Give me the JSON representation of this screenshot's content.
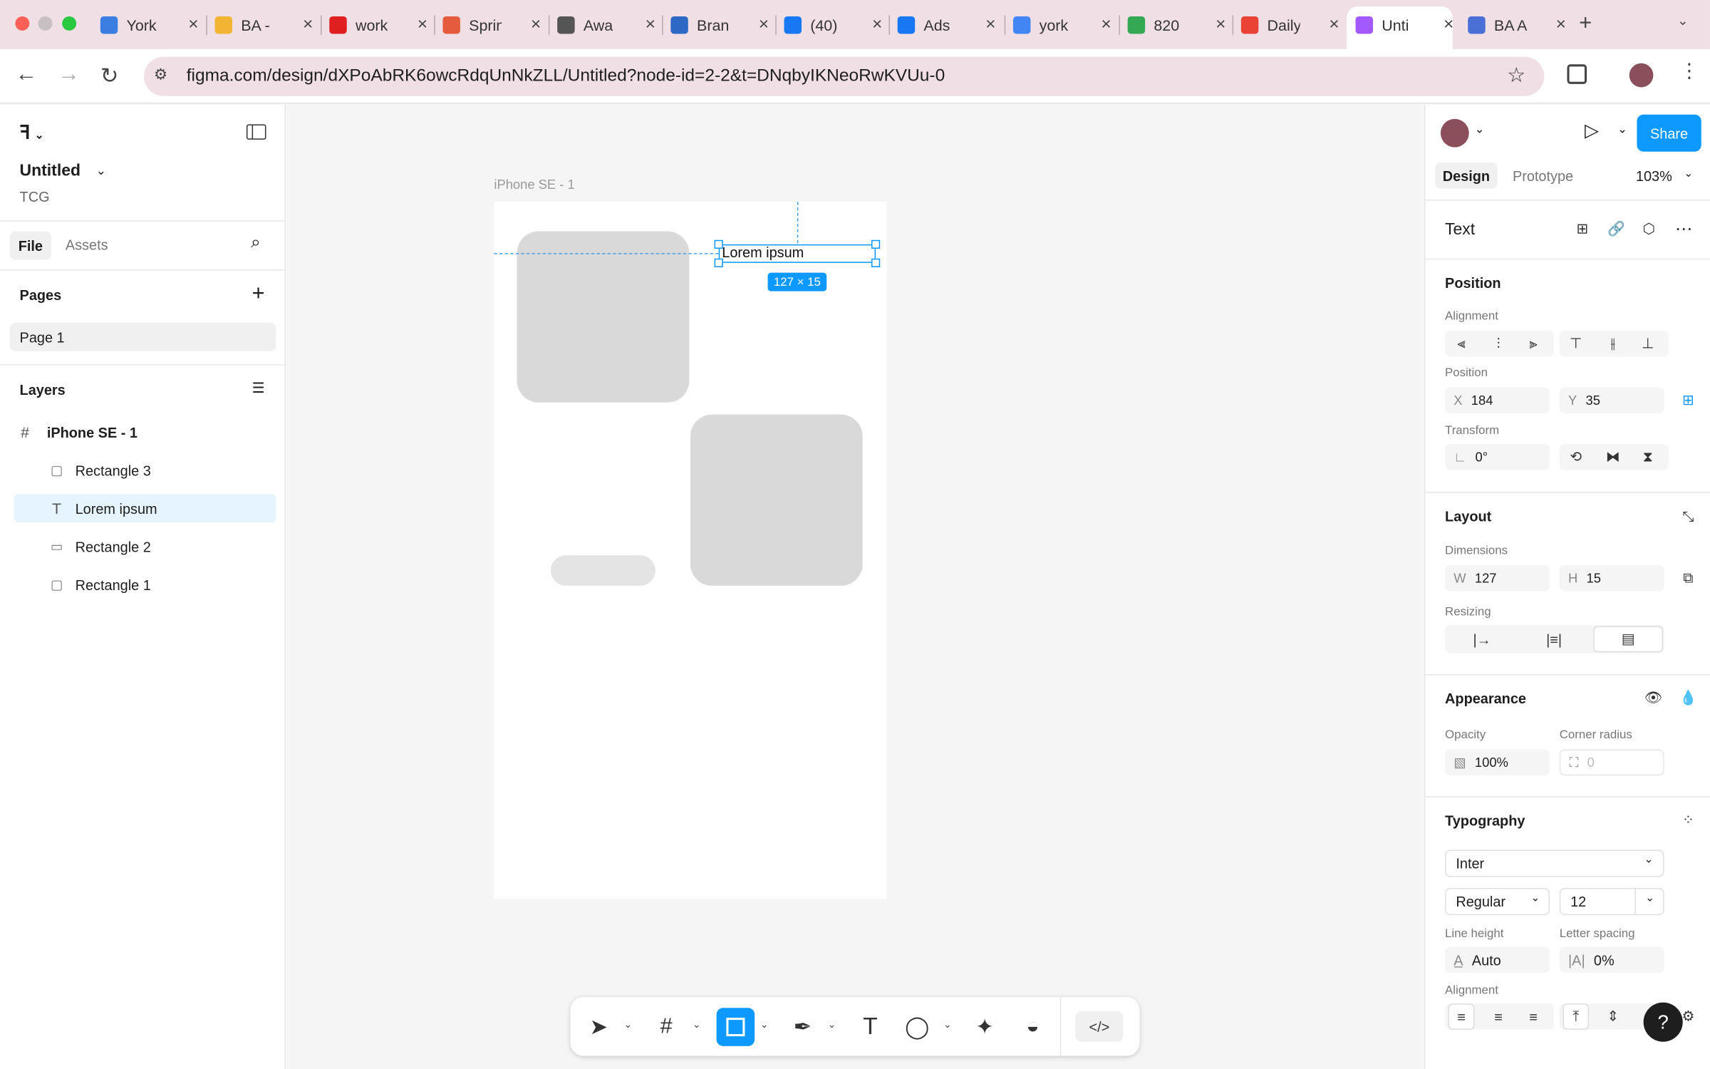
{
  "browser": {
    "tabs": [
      {
        "title": "York",
        "color": "#3b7de0"
      },
      {
        "title": "BA -",
        "color": "#f2b533"
      },
      {
        "title": "work",
        "color": "#e02020"
      },
      {
        "title": "Sprin",
        "color": "#e45b3d"
      },
      {
        "title": "Awa",
        "color": "#555555"
      },
      {
        "title": "Bran",
        "color": "#2d68c4"
      },
      {
        "title": "(40)",
        "color": "#1877f2"
      },
      {
        "title": "Ads",
        "color": "#1877f2"
      },
      {
        "title": "york",
        "color": "#4285f4"
      },
      {
        "title": "820",
        "color": "#34a853"
      },
      {
        "title": "Daily",
        "color": "#ea4335"
      },
      {
        "title": "Unti",
        "color": "#a259ff"
      },
      {
        "title": "BA A",
        "color": "#4a6fd6"
      }
    ],
    "url": "figma.com/design/dXPoAbRK6owcRdqUnNkZLL/Untitled?node-id=2-2&t=DNqbyIKNeoRwKVUu-0"
  },
  "left_panel": {
    "file_name": "Untitled",
    "team": "TCG",
    "tabs": {
      "file": "File",
      "assets": "Assets"
    },
    "pages_title": "Pages",
    "pages": [
      "Page 1"
    ],
    "layers_title": "Layers",
    "frame": "iPhone SE - 1",
    "layers": [
      {
        "name": "Rectangle 3",
        "icon": "rect"
      },
      {
        "name": "Lorem ipsum",
        "icon": "text"
      },
      {
        "name": "Rectangle 2",
        "icon": "pill"
      },
      {
        "name": "Rectangle 1",
        "icon": "rect"
      }
    ]
  },
  "canvas": {
    "frame_label": "iPhone SE - 1",
    "text_content": "Lorem ipsum",
    "size_badge": "127 × 15"
  },
  "right_panel": {
    "tabs": {
      "design": "Design",
      "prototype": "Prototype"
    },
    "zoom": "103%",
    "share": "Share",
    "element_type": "Text",
    "position": {
      "title": "Position",
      "alignment_label": "Alignment",
      "position_label": "Position",
      "x_prefix": "X",
      "x": "184",
      "y_prefix": "Y",
      "y": "35",
      "transform_label": "Transform",
      "rotation": "0°"
    },
    "layout": {
      "title": "Layout",
      "dimensions_label": "Dimensions",
      "w_prefix": "W",
      "w": "127",
      "h_prefix": "H",
      "h": "15",
      "resizing_label": "Resizing"
    },
    "appearance": {
      "title": "Appearance",
      "opacity_label": "Opacity",
      "opacity": "100%",
      "radius_label": "Corner radius",
      "radius": "0"
    },
    "typography": {
      "title": "Typography",
      "font": "Inter",
      "weight": "Regular",
      "size": "12",
      "line_height_label": "Line height",
      "line_height": "Auto",
      "letter_spacing_label": "Letter spacing",
      "letter_spacing": "0%",
      "alignment_label": "Alignment"
    }
  },
  "colors": {
    "accent": "#0d99ff",
    "selection": "#e5f4ff"
  }
}
